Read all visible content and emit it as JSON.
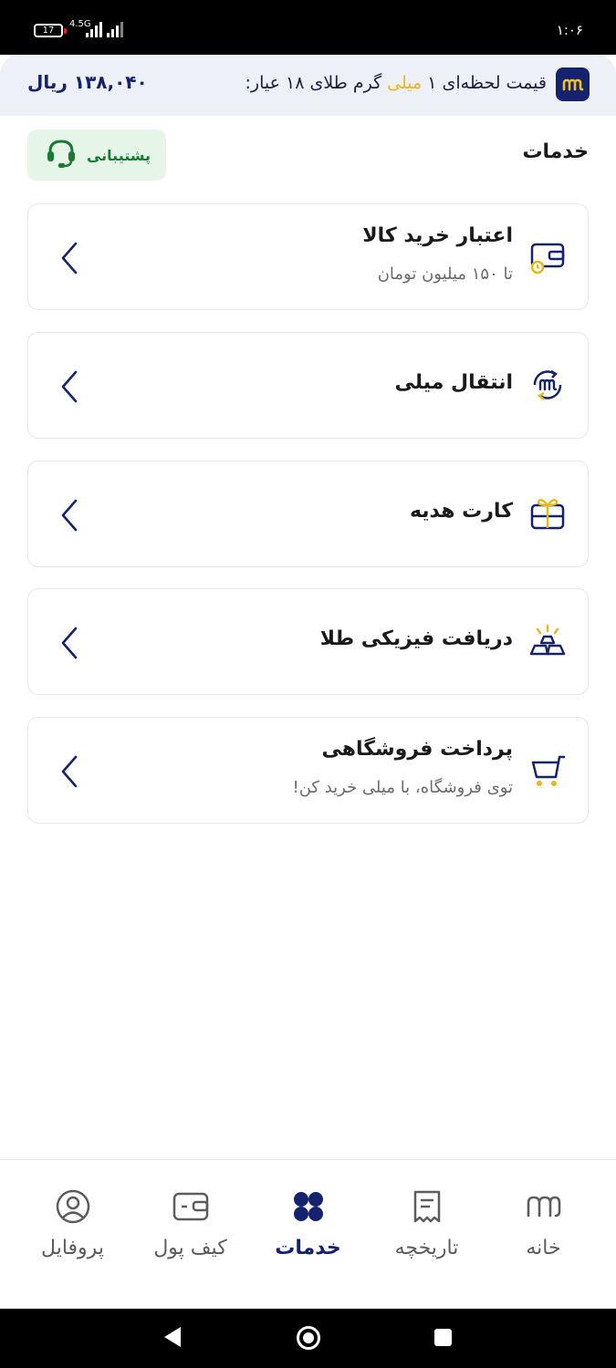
{
  "status_bar": {
    "time": "۱:۰۶",
    "battery": "17",
    "network": "4.5G"
  },
  "price_banner": {
    "label_prefix": "قیمت لحظه‌ای ۱ ",
    "label_highlight": "میلی",
    "label_suffix": " گرم طلای ۱۸ عیار:",
    "price": "۱۳۸,۰۴۰ ریال",
    "logo_icon": "mili-logo-icon"
  },
  "header": {
    "title": "خدمات",
    "support_label": "پشتیبانی"
  },
  "services": [
    {
      "title": "اعتبار خرید کالا",
      "subtitle": "تا ۱۵۰ میلیون تومان",
      "icon": "credit-wallet-icon"
    },
    {
      "title": "انتقال میلی",
      "subtitle": "",
      "icon": "transfer-mili-icon"
    },
    {
      "title": "کارت هدیه",
      "subtitle": "",
      "icon": "gift-card-icon"
    },
    {
      "title": "دریافت فیزیکی طلا",
      "subtitle": "",
      "icon": "gold-bars-icon"
    },
    {
      "title": "پرداخت فروشگاهی",
      "subtitle": "توی فروشگاه، با میلی خرید کن!",
      "icon": "shopping-cart-icon"
    }
  ],
  "bottom_nav": {
    "items": [
      {
        "label": "خانه",
        "icon": "home-mili-icon",
        "active": false
      },
      {
        "label": "تاریخچه",
        "icon": "history-receipt-icon",
        "active": false
      },
      {
        "label": "خدمات",
        "icon": "services-grid-icon",
        "active": true
      },
      {
        "label": "کیف پول",
        "icon": "wallet-icon",
        "active": false
      },
      {
        "label": "پروفایل",
        "icon": "profile-icon",
        "active": false
      }
    ]
  },
  "colors": {
    "brand_navy": "#15226e",
    "accent_gold": "#e9b71a",
    "support_green": "#187a33"
  }
}
